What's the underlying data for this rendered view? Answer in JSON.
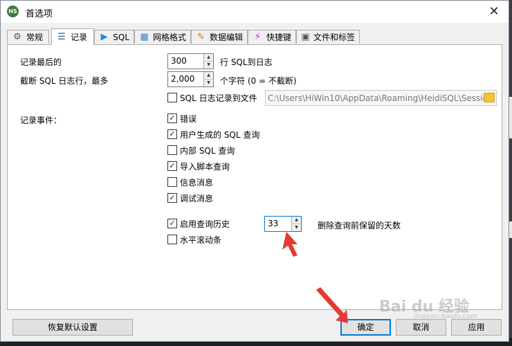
{
  "window": {
    "title": "首选项",
    "app_icon_text": "HS"
  },
  "tabs": [
    {
      "label": "常规",
      "icon": "gear-icon"
    },
    {
      "label": "记录",
      "icon": "list-icon",
      "active": true
    },
    {
      "label": "SQL",
      "icon": "play-icon"
    },
    {
      "label": "网格格式",
      "icon": "grid-icon"
    },
    {
      "label": "数据编辑",
      "icon": "edit-icon"
    },
    {
      "label": "快捷键",
      "icon": "lightning-icon"
    },
    {
      "label": "文件和标签",
      "icon": "file-icon"
    }
  ],
  "logging": {
    "log_last_label": "记录最后的",
    "log_last_value": "300",
    "log_last_suffix": "行 SQL到日志",
    "truncate_label": "截断 SQL 日志行，最多",
    "truncate_value": "2,000",
    "truncate_suffix": "个字符 (0 = 不截断)",
    "log_to_file_label": "SQL 日志记录到文件",
    "log_to_file_checked": false,
    "log_file_path": "C:\\Users\\HiWin10\\AppData\\Roaming\\HeidiSQL\\Sessio",
    "events_label": "记录事件："
  },
  "events": [
    {
      "label": "错误",
      "checked": true
    },
    {
      "label": "用户生成的 SQL 查询",
      "checked": true
    },
    {
      "label": "内部 SQL 查询",
      "checked": false
    },
    {
      "label": "导入脚本查询",
      "checked": true
    },
    {
      "label": "信息消息",
      "checked": false
    },
    {
      "label": "调试消息",
      "checked": true
    }
  ],
  "history": {
    "enable_label": "启用查询历史",
    "enable_checked": true,
    "days_value": "33",
    "days_suffix": "删除查询前保留的天数",
    "hscroll_label": "水平滚动条",
    "hscroll_checked": false
  },
  "buttons": {
    "restore_defaults": "恢复默认设置",
    "ok": "确定",
    "cancel": "取消",
    "apply": "应用"
  },
  "watermark": {
    "brand": "Bai du 经验",
    "url": "jingyan.baidu.com"
  },
  "colors": {
    "accent": "#0078d7",
    "annotation_arrow": "#e53935"
  }
}
